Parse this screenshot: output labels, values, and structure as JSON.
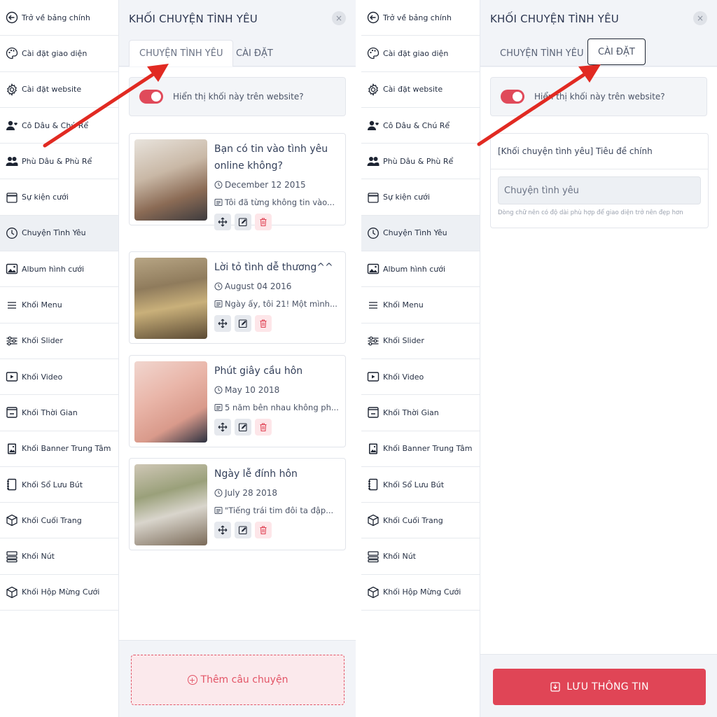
{
  "sidebar": {
    "items": [
      {
        "label": "Trở về bảng chính",
        "icon": "back-arrow-icon"
      },
      {
        "label": "Cài đặt giao diện",
        "icon": "palette-icon"
      },
      {
        "label": "Cài đặt website",
        "icon": "gear-icon"
      },
      {
        "label": "Cô Dâu & Chú Rể",
        "icon": "user-heart-icon"
      },
      {
        "label": "Phù Dâu & Phù Rể",
        "icon": "users-icon"
      },
      {
        "label": "Sự kiện cưới",
        "icon": "calendar-icon"
      },
      {
        "label": "Chuyện Tình Yêu",
        "icon": "clock-icon"
      },
      {
        "label": "Album hình cưới",
        "icon": "image-icon"
      },
      {
        "label": "Khối Menu",
        "icon": "menu-icon"
      },
      {
        "label": "Khối Slider",
        "icon": "sliders-icon"
      },
      {
        "label": "Khối Video",
        "icon": "video-icon"
      },
      {
        "label": "Khối Thời Gian",
        "icon": "timer-icon"
      },
      {
        "label": "Khối Banner Trung Tâm",
        "icon": "banner-icon"
      },
      {
        "label": "Khối Sổ Lưu Bút",
        "icon": "notebook-icon"
      },
      {
        "label": "Khối Cuối Trang",
        "icon": "box-icon"
      },
      {
        "label": "Khối Nút",
        "icon": "button-stack-icon"
      },
      {
        "label": "Khối Hộp Mừng Cưới",
        "icon": "gift-box-icon"
      }
    ],
    "active_index": 6
  },
  "panel": {
    "title": "KHỐI CHUYỆN TÌNH YÊU",
    "close": "×",
    "tabs": {
      "story": "CHUYỆN TÌNH YÊU",
      "settings": "CÀI ĐẶT"
    },
    "toggle_label": "Hiển thị khối này trên website?"
  },
  "stories": [
    {
      "title": "Bạn có tin vào tình yêu online không?",
      "date": "December 12 2015",
      "excerpt": "Tôi đã từng không tin vào..."
    },
    {
      "title": "Lời tỏ tình dễ thương^^",
      "date": "August 04 2016",
      "excerpt": "Ngày ấy, tôi 21! Một mình..."
    },
    {
      "title": "Phút giây cầu hôn",
      "date": "May 10 2018",
      "excerpt": "5 năm bên nhau không ph..."
    },
    {
      "title": "Ngày lễ đính hôn",
      "date": "July 28 2018",
      "excerpt": "\"Tiếng trái tim đôi ta đập..."
    }
  ],
  "add_story_label": "Thêm câu chuyện",
  "settings_form": {
    "label": "[Khối chuyện tình yêu] Tiêu đề chính",
    "value": "Chuyện tình yêu",
    "hint": "Dòng chữ nên có độ dài phù hợp để giao diện trở nên đẹp hơn"
  },
  "save_label": "LƯU THÔNG TIN",
  "colors": {
    "accent": "#e04556",
    "arrow": "#e12a22",
    "active_bg": "#edf0f4"
  }
}
